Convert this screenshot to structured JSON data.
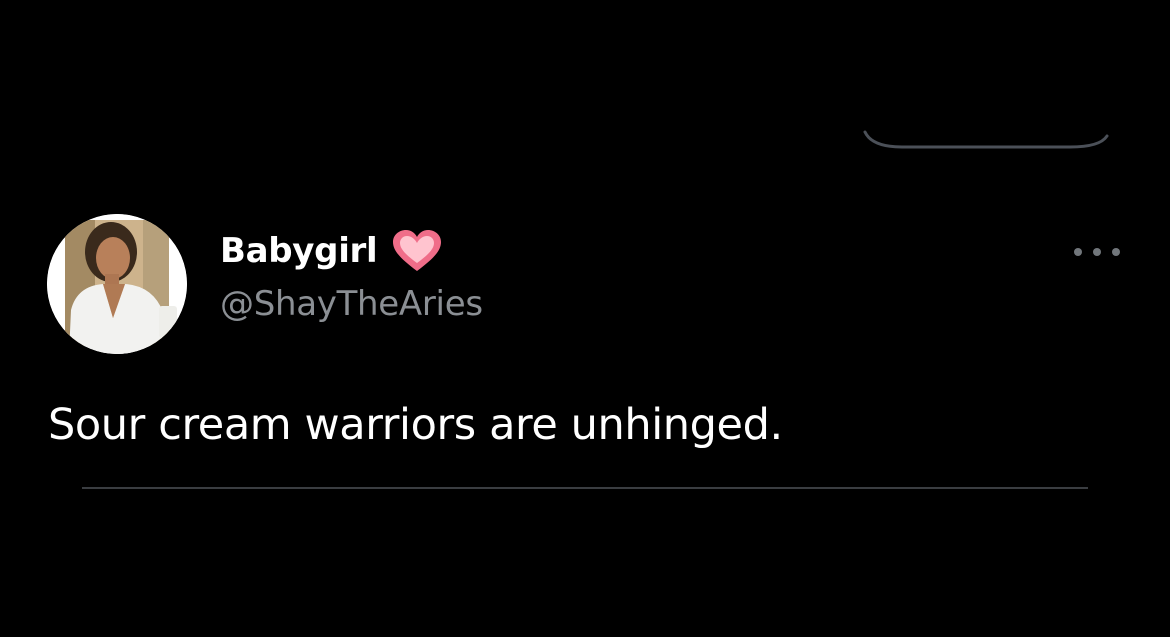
{
  "tweet": {
    "display_name": "Babygirl",
    "handle": "@ShayTheAries",
    "text": "Sour cream warriors are unhinged.",
    "badge_icon": "pink-heart-emoji-icon",
    "more_icon": "more-horizontal-icon"
  },
  "colors": {
    "background": "#000000",
    "primary_text": "#ffffff",
    "secondary_text": "#8b8f94",
    "divider": "#3a3d41",
    "heart": "#f0748f"
  }
}
